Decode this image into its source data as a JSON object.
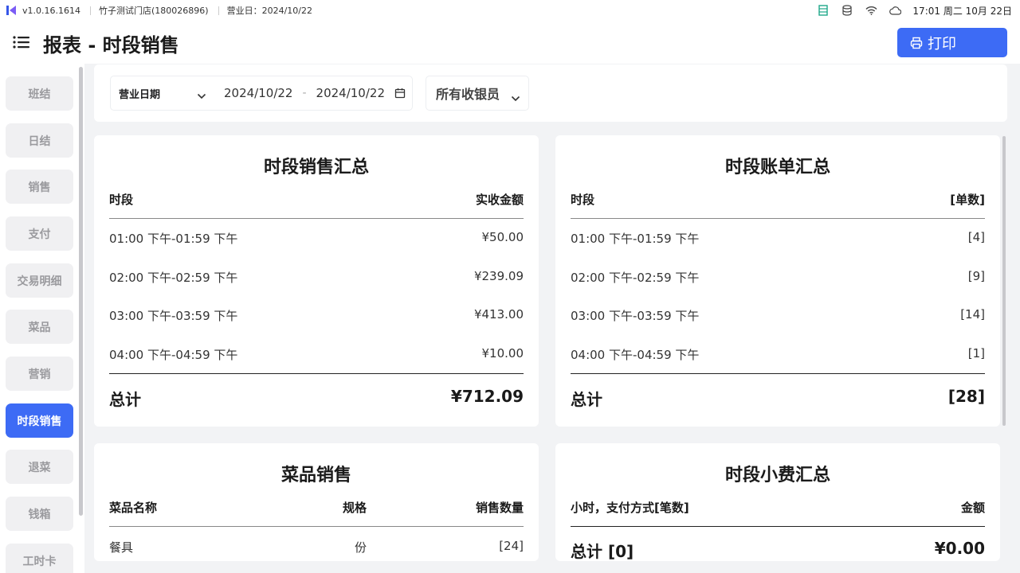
{
  "statusbar": {
    "version": "v1.0.16.1614",
    "store": "竹子测试门店(180026896)",
    "business_date": "营业日：2024/10/22",
    "clock": "17:01 周二 10月 22日",
    "icons": [
      "list-icon",
      "database-icon",
      "wifi-icon",
      "cloud-icon"
    ]
  },
  "header": {
    "title": "报表 - 时段销售",
    "print_label": "打印"
  },
  "sidebar": {
    "items": [
      {
        "label": "班结"
      },
      {
        "label": "日结"
      },
      {
        "label": "销售"
      },
      {
        "label": "支付"
      },
      {
        "label": "交易明细"
      },
      {
        "label": "菜品"
      },
      {
        "label": "营销"
      },
      {
        "label": "时段销售",
        "active": true
      },
      {
        "label": "退菜"
      },
      {
        "label": "钱箱"
      },
      {
        "label": "工时卡"
      }
    ]
  },
  "filter": {
    "date_type": "营业日期",
    "start_date": "2024/10/22",
    "separator": "-",
    "end_date": "2024/10/22",
    "cashier": "所有收银员"
  },
  "sales_summary": {
    "title": "时段销售汇总",
    "col_period": "时段",
    "col_amount": "实收金额",
    "rows": [
      {
        "period": "01:00 下午-01:59 下午",
        "amount": "¥50.00"
      },
      {
        "period": "02:00 下午-02:59 下午",
        "amount": "¥239.09"
      },
      {
        "period": "03:00 下午-03:59 下午",
        "amount": "¥413.00"
      },
      {
        "period": "04:00 下午-04:59 下午",
        "amount": "¥10.00"
      }
    ],
    "total_label": "总计",
    "total_value": "¥712.09"
  },
  "bill_summary": {
    "title": "时段账单汇总",
    "col_period": "时段",
    "col_count": "[单数]",
    "rows": [
      {
        "period": "01:00 下午-01:59 下午",
        "count": "[4]"
      },
      {
        "period": "02:00 下午-02:59 下午",
        "count": "[9]"
      },
      {
        "period": "03:00 下午-03:59 下午",
        "count": "[14]"
      },
      {
        "period": "04:00 下午-04:59 下午",
        "count": "[1]"
      }
    ],
    "total_label": "总计",
    "total_value": "[28]"
  },
  "dish_sales": {
    "title": "菜品销售",
    "col_name": "菜品名称",
    "col_spec": "规格",
    "col_qty": "销售数量",
    "rows": [
      {
        "name": "餐具",
        "spec": "份",
        "qty": "[24]"
      }
    ]
  },
  "tip_summary": {
    "title": "时段小费汇总",
    "col_hour": "小时，支付方式[笔数]",
    "col_amount": "金额",
    "total_label": "总计 [0]",
    "total_value": "¥0.00"
  },
  "colors": {
    "accent": "#3d6bf5",
    "background": "#f2f3f5"
  }
}
